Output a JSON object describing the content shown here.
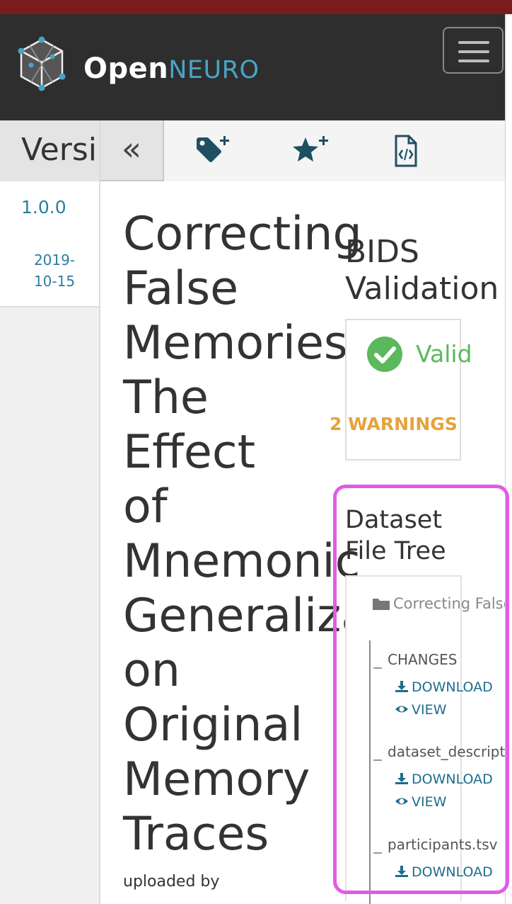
{
  "app": {
    "brand_open": "Open",
    "brand_neuro": "NEURO",
    "colors": {
      "accent": "#2b7ea1",
      "nav_bg": "#2e2e2e",
      "top_stripe": "#7a1c1c",
      "valid": "#5cb85c",
      "warning": "#e6a23c",
      "highlight": "#e35ae6"
    }
  },
  "navbar": {
    "menu_icon": "hamburger-menu-icon",
    "logo_icon": "openneuro-cube-logo"
  },
  "toolbar": {
    "versions_tab_label": "Versi",
    "collapse_label": "«",
    "tools": [
      {
        "icon": "tag-plus-icon"
      },
      {
        "icon": "star-plus-icon"
      },
      {
        "icon": "file-code-icon"
      }
    ]
  },
  "sidebar": {
    "version": "1.0.0",
    "date_line1": "2019-",
    "date_line2": "10-15"
  },
  "dataset": {
    "title_lines": [
      "Correcting",
      "False",
      "Memories:",
      "The",
      "Effect",
      "of",
      "Mnemonic",
      "Generalization",
      "on",
      "Original",
      "Memory",
      "Traces"
    ],
    "uploaded_by": "uploaded by"
  },
  "validation": {
    "heading_line1": "BIDS",
    "heading_line2": "Validation",
    "status": "Valid",
    "warnings": "2 WARNINGS"
  },
  "file_tree": {
    "heading_line1": "Dataset",
    "heading_line2": "File Tree",
    "root_folder": "Correcting False",
    "files": [
      {
        "name": "CHANGES",
        "download": "DOWNLOAD",
        "view": "VIEW"
      },
      {
        "name": "dataset_descript",
        "download": "DOWNLOAD",
        "view": "VIEW"
      },
      {
        "name": "participants.tsv",
        "download": "DOWNLOAD"
      }
    ]
  }
}
